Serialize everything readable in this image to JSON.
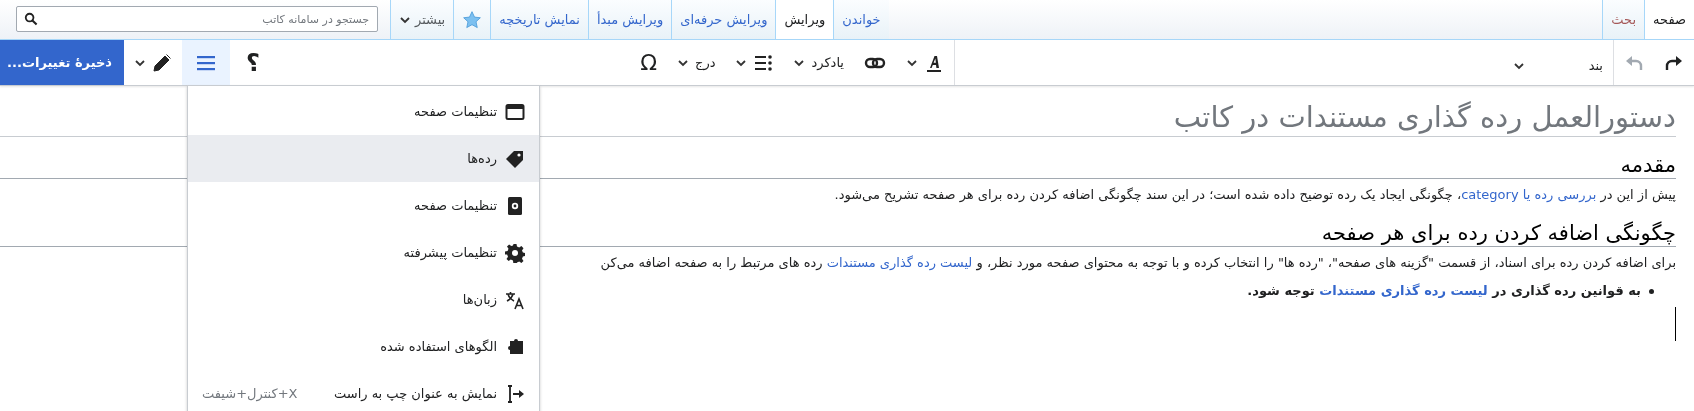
{
  "page_tabs": [
    {
      "label": "صفحه",
      "selected": true,
      "missing": false
    },
    {
      "label": "بحث",
      "selected": false,
      "missing": true
    }
  ],
  "view_tabs": [
    {
      "label": "خواندن",
      "selected": false
    },
    {
      "label": "ویرایش",
      "selected": true
    },
    {
      "label": "ویرایش حرفه‌ای",
      "selected": false
    },
    {
      "label": "ویرایش مبدأ",
      "selected": false
    },
    {
      "label": "نمایش تاریخچه",
      "selected": false
    }
  ],
  "watch": {
    "on": false
  },
  "more": {
    "label": "بیشتر"
  },
  "search": {
    "placeholder": "جستجو در سامانه کاتب"
  },
  "toolbar": {
    "redo": {
      "disabled": false
    },
    "undo": {
      "disabled": true
    },
    "paragraph": "بند",
    "cite": "یادکرد",
    "insert": "درج",
    "special": "Ω",
    "help": "؟",
    "menu_open": true
  },
  "save_button": {
    "label": "ذخیرهٔ تغییرات..."
  },
  "menu": {
    "items": [
      {
        "label": "تنظیمات صفحه",
        "selected": false
      },
      {
        "label": "رده‌ها",
        "selected": true
      },
      {
        "label": "تنظیمات صفحه",
        "selected": false
      },
      {
        "label": "تنظیمات پیشرفته",
        "selected": false
      },
      {
        "label": "زبان‌ها",
        "selected": false
      },
      {
        "label": "الگوهای استفاده شده",
        "selected": false
      },
      {
        "label": "نمایش به عنوان چپ به راست",
        "selected": false,
        "shortcut": "X+کنترل+شیفت"
      }
    ]
  },
  "content": {
    "title": "دستورالعمل رده گذاری مستندات در کاتب",
    "blocks": [
      {
        "kind": "heading",
        "text": "مقدمه"
      },
      {
        "kind": "paragraph",
        "segments": [
          {
            "text": "پیش از این در ",
            "link": false
          },
          {
            "text": "بررسی رده یا category",
            "link": true
          },
          {
            "text": "، چگونگی ایجاد یک رده توضیح داده شده است؛ در این سند چگونگی اضافه کردن رده برای هر صفحه تشریح می‌شود.",
            "link": false
          }
        ]
      },
      {
        "kind": "heading",
        "text": "چگونگی اضافه کردن رده برای هر صفحه"
      },
      {
        "kind": "paragraph",
        "segments": [
          {
            "text": "برای اضافه کردن رده برای اسناد، از قسمت \"گزینه های صفحه\"، \"رده ها\" را انتخاب کرده و با توجه به محتوای صفحه مورد نظر، و ",
            "link": false
          },
          {
            "text": "لیست رده گذاری مستندات",
            "link": true
          },
          {
            "text": " رده های مرتبط را به صفحه اضافه می‌کن",
            "link": false
          }
        ]
      },
      {
        "kind": "bullet",
        "segments": [
          {
            "text": "به قوانین رده گذاری در ",
            "link": false
          },
          {
            "text": "لیست رده گذاری مستندات",
            "link": true
          },
          {
            "text": " توجه شود.",
            "link": false
          }
        ]
      }
    ]
  }
}
